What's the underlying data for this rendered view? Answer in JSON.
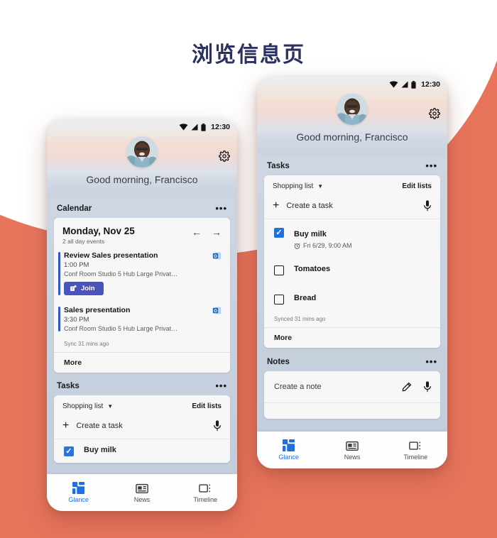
{
  "page": {
    "title": "浏览信息页",
    "title_color": "#2b3160",
    "background_color": "#e8745c"
  },
  "status_bar": {
    "time": "12:30",
    "icons": [
      "wifi-icon",
      "signal-icon",
      "battery-icon"
    ]
  },
  "header": {
    "greeting": "Good morning, Francisco",
    "settings_icon": "gear-icon",
    "avatar": "avatar"
  },
  "calendar": {
    "section_label": "Calendar",
    "overflow": "•••",
    "date": "Monday, Nov 25",
    "subtitle": "2 all day events",
    "prev": "←",
    "next": "→",
    "events": [
      {
        "title": "Review Sales presentation",
        "time": "1:00 PM",
        "location": "Conf Room Studio 5 Hub Large Privat…",
        "join_label": "Join",
        "has_join": true
      },
      {
        "title": "Sales presentation",
        "time": "3:30 PM",
        "location": "Conf Room Studio 5 Hub Large Privat…",
        "join_label": "",
        "has_join": false
      }
    ],
    "sync": "Sync 31 mins ago",
    "more": "More"
  },
  "tasks": {
    "section_label": "Tasks",
    "overflow": "•••",
    "list_name": "Shopping list",
    "caret": "▼",
    "edit_lists": "Edit lists",
    "create_label": "Create a task",
    "plus": "+",
    "mic_icon": "microphone-icon",
    "items": [
      {
        "name": "Buy milk",
        "due": "Fri 6/29, 9:00 AM",
        "checked": true
      },
      {
        "name": "Tomatoes",
        "due": "",
        "checked": false
      },
      {
        "name": "Bread",
        "due": "",
        "checked": false
      }
    ],
    "sync": "Synced 31 mins ago",
    "more": "More",
    "peek_item": "Buy milk"
  },
  "notes": {
    "section_label": "Notes",
    "overflow": "•••",
    "create_label": "Create a note",
    "pencil_icon": "pencil-icon",
    "mic_icon": "microphone-icon"
  },
  "bottom_nav": {
    "items": [
      {
        "label": "Glance",
        "icon": "glance-icon",
        "active": true
      },
      {
        "label": "News",
        "icon": "news-icon",
        "active": false
      },
      {
        "label": "Timeline",
        "icon": "timeline-icon",
        "active": false
      }
    ],
    "active_color": "#1f6fdd"
  }
}
